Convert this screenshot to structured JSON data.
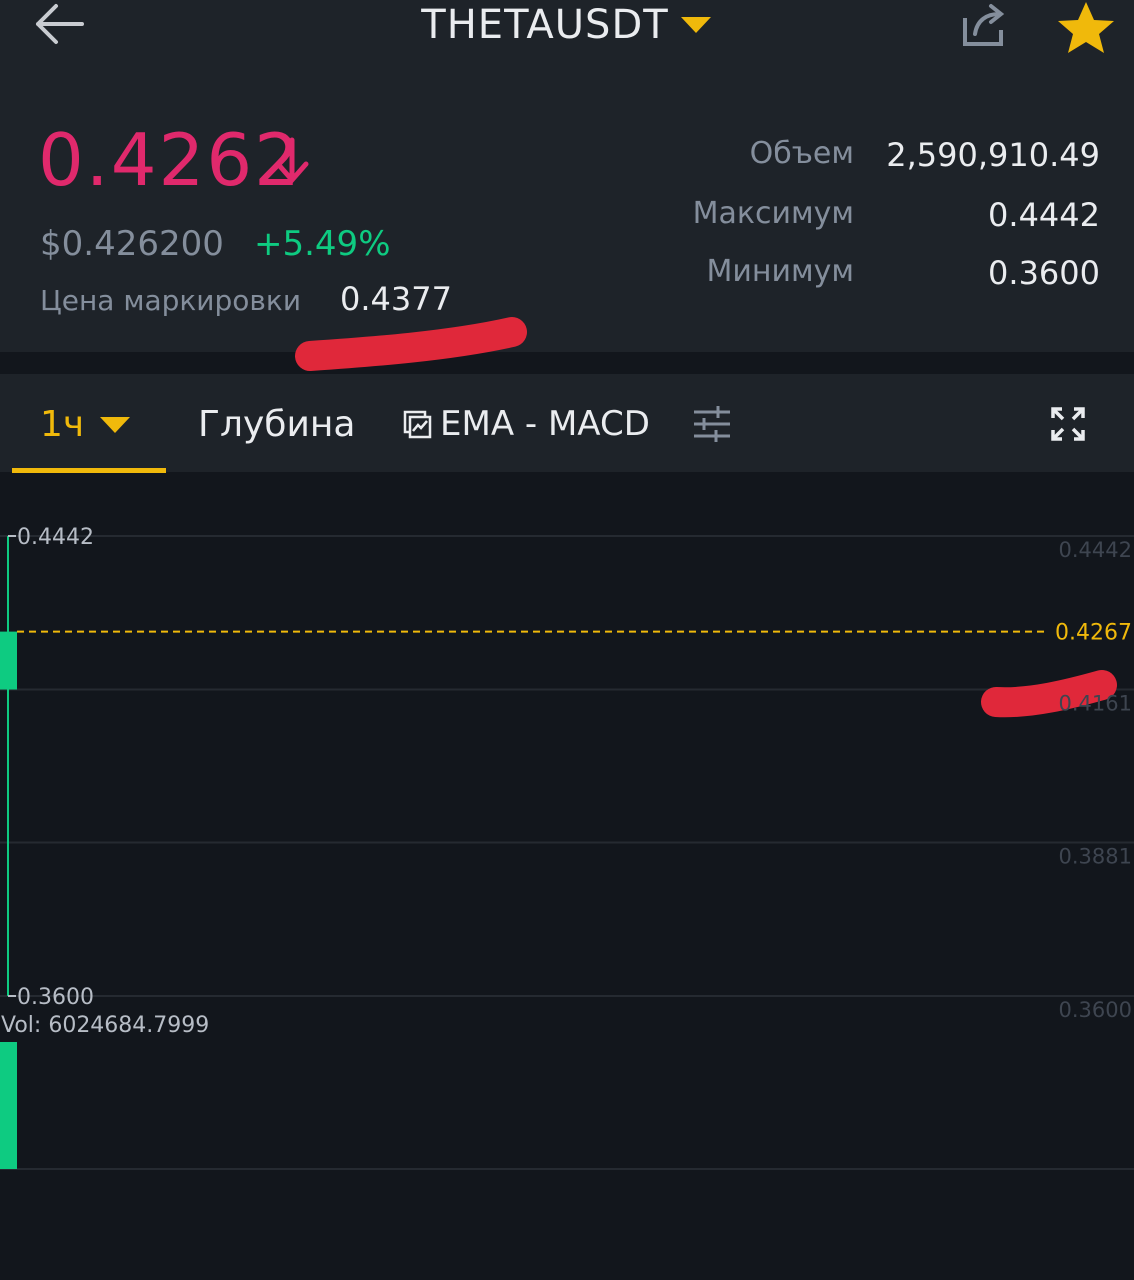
{
  "header": {
    "pair": "THETAUSDT"
  },
  "ticker": {
    "last_price": "0.4262",
    "usd_price": "$0.426200",
    "change_percent": "+5.49%",
    "mark_label": "Цена маркировки",
    "mark_price": "0.4377",
    "volume_label": "Объем",
    "volume_value": "2,590,910.49",
    "high_label": "Максимум",
    "high_value": "0.4442",
    "low_label": "Минимум",
    "low_value": "0.3600"
  },
  "tabs": {
    "interval": "1ч",
    "depth": "Глубина",
    "indicators": "EMA - MACD"
  },
  "colors": {
    "up": "#0ecb81",
    "down": "#e0296c",
    "accent": "#f0b90b"
  },
  "chart_data": {
    "type": "candlestick",
    "y_ticks": [
      "0.4442",
      "0.4161",
      "0.3881",
      "0.3600"
    ],
    "y_range": [
      0.36,
      0.4442
    ],
    "current_price_label": "0.4267",
    "current_price": 0.4267,
    "high_marker": "0.4442",
    "low_marker": "0.3600",
    "volume_label": "Vol: 6024684.7999",
    "candle": {
      "open": 0.4161,
      "close": 0.4267,
      "high": 0.4442,
      "low": 0.36
    }
  }
}
